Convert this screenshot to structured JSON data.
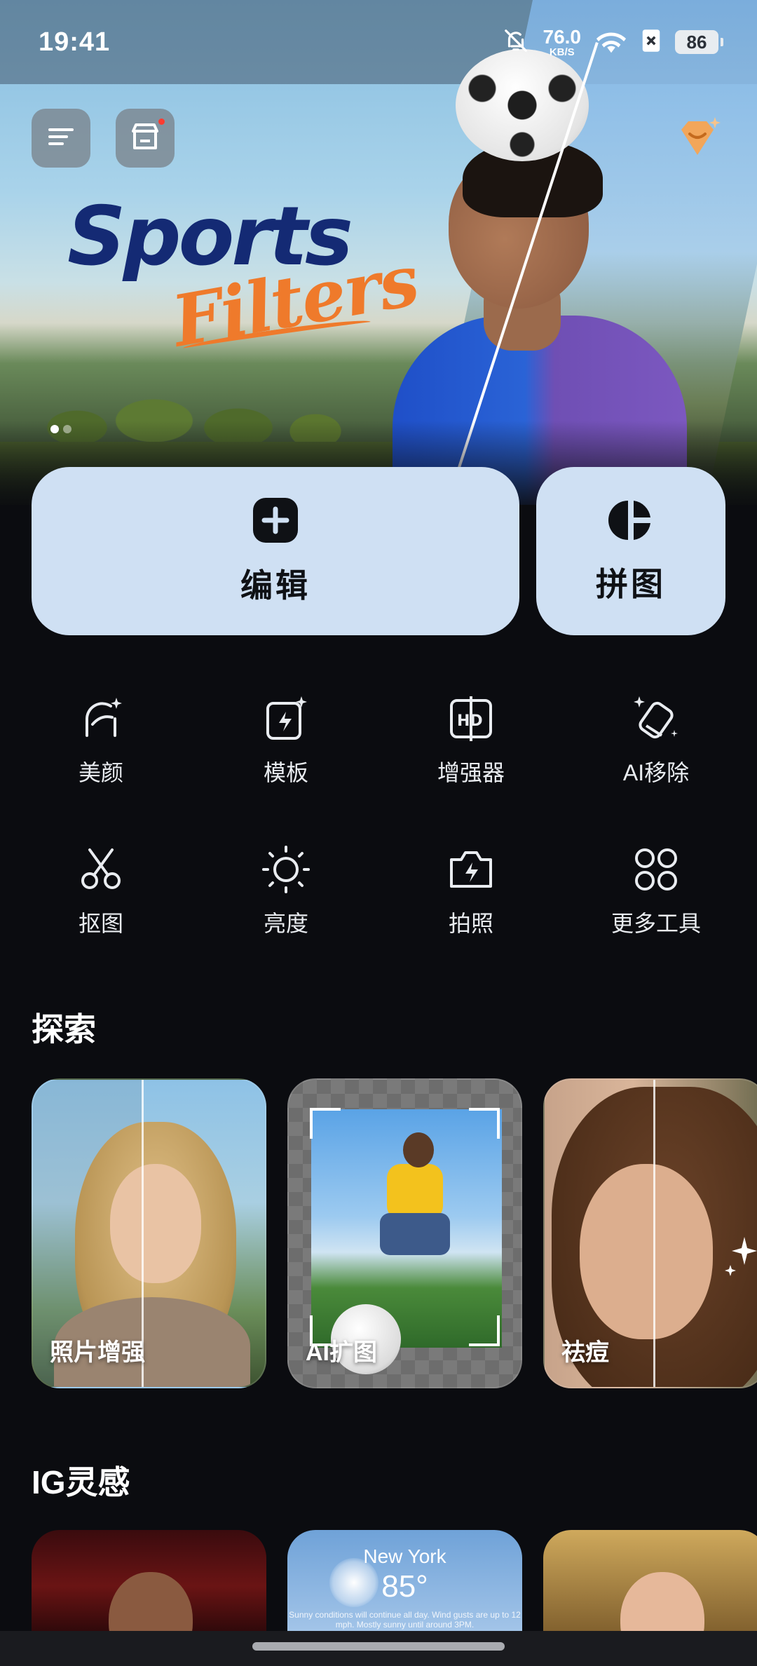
{
  "status_bar": {
    "time": "19:41",
    "net_speed_value": "76.0",
    "net_speed_unit": "KB/S",
    "battery": "86",
    "icons": [
      "mute-bell-icon",
      "wifi-icon",
      "sim-off-icon",
      "battery-icon"
    ]
  },
  "hero": {
    "logo_main": "Sports",
    "logo_sub": "Filters",
    "top_buttons": [
      "menu-icon",
      "store-icon",
      "premium-diamond-icon"
    ]
  },
  "actions": {
    "edit_label": "编辑",
    "collage_label": "拼图"
  },
  "tools": [
    {
      "label": "美颜",
      "icon": "face-beauty-icon"
    },
    {
      "label": "模板",
      "icon": "template-icon"
    },
    {
      "label": "增强器",
      "icon": "hd-enhancer-icon"
    },
    {
      "label": "AI移除",
      "icon": "eraser-icon"
    },
    {
      "label": "抠图",
      "icon": "scissors-icon"
    },
    {
      "label": "亮度",
      "icon": "sun-icon"
    },
    {
      "label": "拍照",
      "icon": "camera-icon"
    },
    {
      "label": "更多工具",
      "icon": "more-grid-icon"
    }
  ],
  "explore": {
    "title": "探索",
    "cards": [
      {
        "title": "照片增强"
      },
      {
        "title": "AI扩图"
      },
      {
        "title": "祛痘"
      }
    ]
  },
  "ig": {
    "title": "IG灵感",
    "weather_card": {
      "city": "New York",
      "temp": "85°",
      "condition": "Sunny conditions will continue all day. Wind gusts are up to 12 mph. Mostly sunny until around 3PM."
    }
  },
  "colors": {
    "background": "#0b0c10",
    "card": "#cfe0f3",
    "accent_orange": "#ef7a2b",
    "logo_navy": "#142a74"
  }
}
